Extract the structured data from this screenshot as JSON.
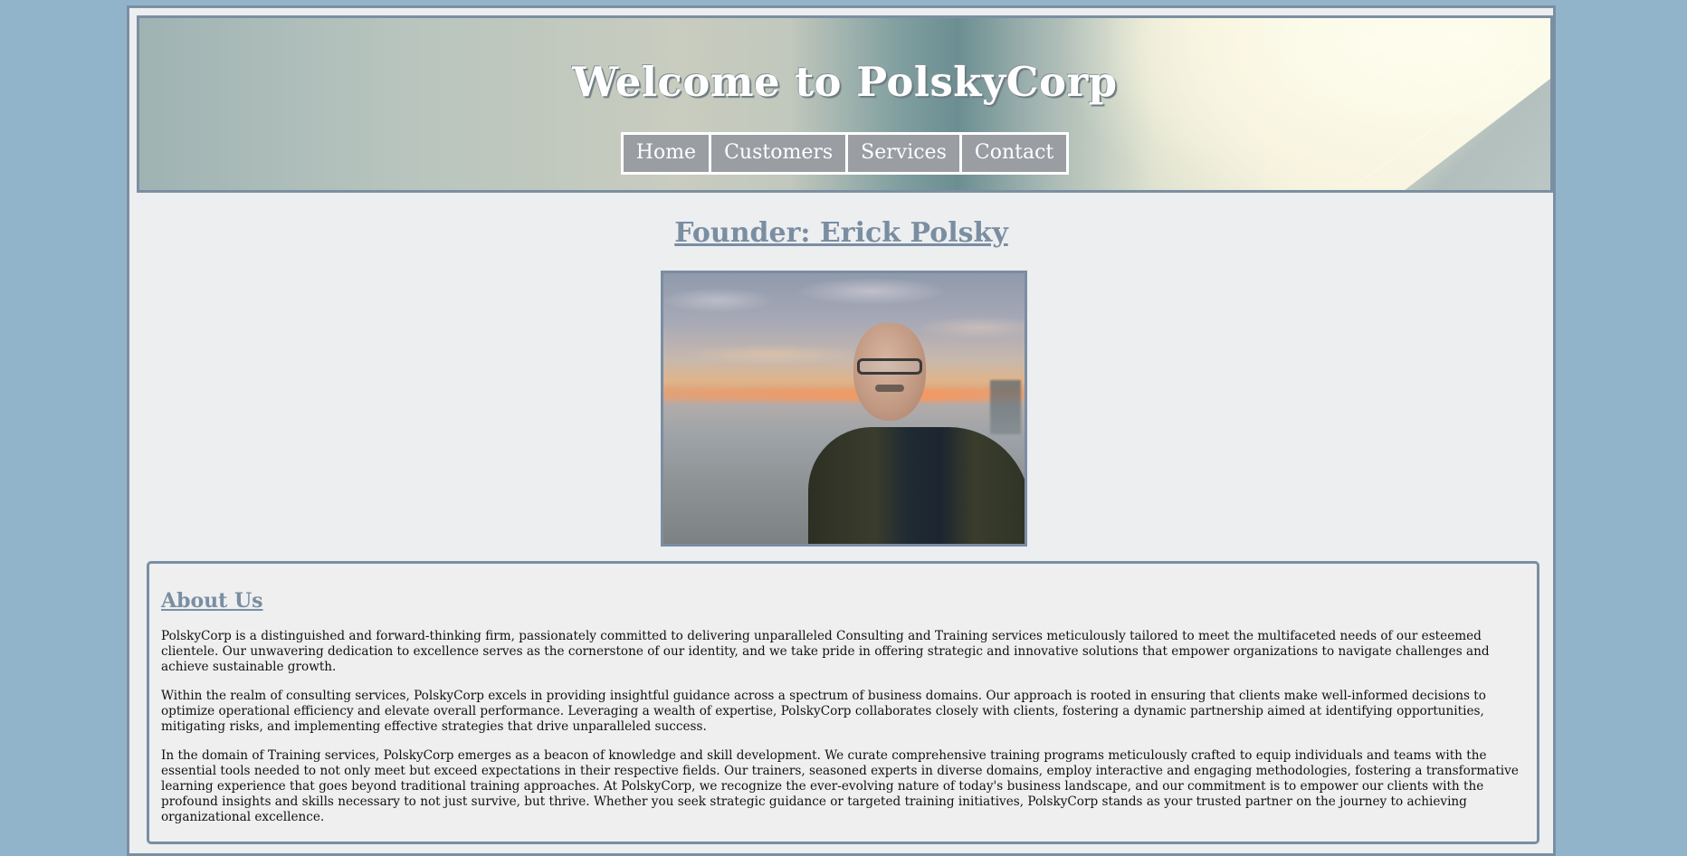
{
  "header": {
    "title": "Welcome to PolskyCorp",
    "nav": [
      {
        "label": "Home"
      },
      {
        "label": "Customers"
      },
      {
        "label": "Services"
      },
      {
        "label": "Contact"
      }
    ]
  },
  "founder": {
    "heading": "Founder: Erick Polsky",
    "photo_alt": "Erick Polsky"
  },
  "about": {
    "heading": "About Us",
    "paragraphs": [
      "PolskyCorp is a distinguished and forward-thinking firm, passionately committed to delivering unparalleled Consulting and Training services meticulously tailored to meet the multifaceted needs of our esteemed clientele. Our unwavering dedication to excellence serves as the cornerstone of our identity, and we take pride in offering strategic and innovative solutions that empower organizations to navigate challenges and achieve sustainable growth.",
      "Within the realm of consulting services, PolskyCorp excels in providing insightful guidance across a spectrum of business domains. Our approach is rooted in ensuring that clients make well-informed decisions to optimize operational efficiency and elevate overall performance. Leveraging a wealth of expertise, PolskyCorp collaborates closely with clients, fostering a dynamic partnership aimed at identifying opportunities, mitigating risks, and implementing effective strategies that drive unparalleled success.",
      "In the domain of Training services, PolskyCorp emerges as a beacon of knowledge and skill development. We curate comprehensive training programs meticulously crafted to equip individuals and teams with the essential tools needed to not only meet but exceed expectations in their respective fields. Our trainers, seasoned experts in diverse domains, employ interactive and engaging methodologies, fostering a transformative learning experience that goes beyond traditional training approaches. At PolskyCorp, we recognize the ever-evolving nature of today's business landscape, and our commitment is to empower our clients with the profound insights and skills necessary to not just survive, but thrive. Whether you seek strategic guidance or targeted training initiatives, PolskyCorp stands as your trusted partner on the journey to achieving organizational excellence."
    ]
  },
  "colors": {
    "page_background": "#92b4cb",
    "accent": "#7a8ea2",
    "nav_button": "#9a9ea3"
  }
}
